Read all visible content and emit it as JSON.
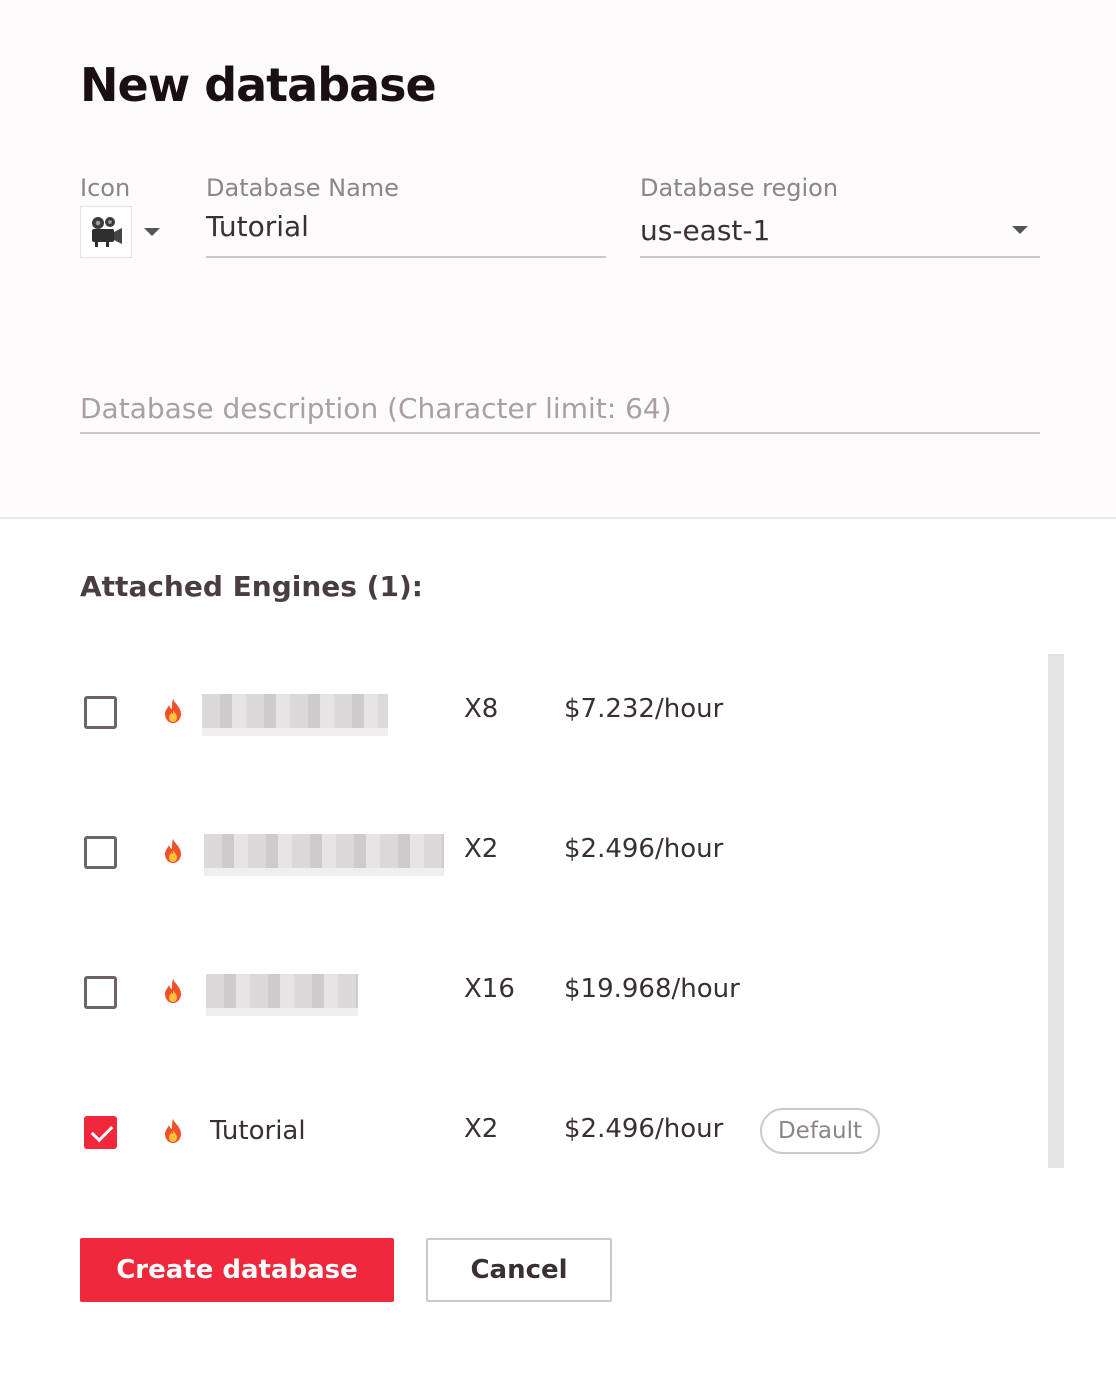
{
  "dialog": {
    "title": "New database"
  },
  "form": {
    "icon_label": "Icon",
    "icon_name": "movie-camera-icon",
    "name_label": "Database Name",
    "name_value": "Tutorial",
    "region_label": "Database region",
    "region_value": "us-east-1",
    "description_placeholder": "Database description (Character limit: 64)"
  },
  "engines": {
    "heading": "Attached Engines (1):",
    "rows": [
      {
        "checked": false,
        "name": "",
        "name_redacted": true,
        "scale": "X8",
        "price": "$7.232/hour",
        "badge": ""
      },
      {
        "checked": false,
        "name": "",
        "name_redacted": true,
        "scale": "X2",
        "price": "$2.496/hour",
        "badge": ""
      },
      {
        "checked": false,
        "name": "",
        "name_redacted": true,
        "scale": "X16",
        "price": "$19.968/hour",
        "badge": ""
      },
      {
        "checked": true,
        "name": "Tutorial",
        "name_redacted": false,
        "scale": "X2",
        "price": "$2.496/hour",
        "badge": "Default"
      }
    ]
  },
  "actions": {
    "create_label": "Create database",
    "cancel_label": "Cancel"
  },
  "colors": {
    "accent": "#f0283c",
    "title": "#1a0f12",
    "muted_text": "#8d8488"
  }
}
